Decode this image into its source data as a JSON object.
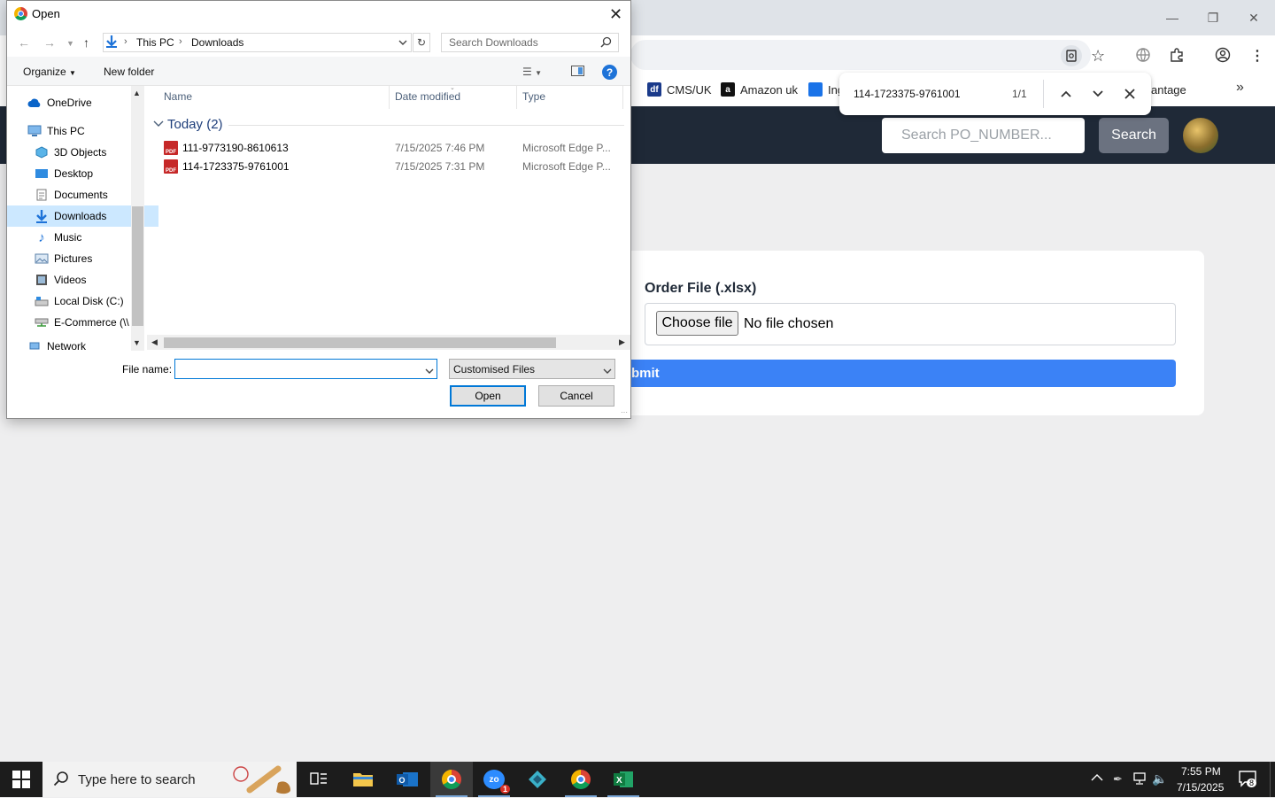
{
  "browser": {
    "bookmarks": [
      {
        "label": "CMS/UK",
        "icon_text": "df",
        "color": "#1a3a8a"
      },
      {
        "label": "Amazon uk",
        "icon_text": "a",
        "color": "#111111"
      },
      {
        "label": "Ing",
        "icon_text": "",
        "color": "#1a73e8"
      },
      {
        "label": "antage"
      }
    ],
    "more_bookmarks": "»"
  },
  "find_bar": {
    "query": "114-1723375-9761001",
    "count": "1/1"
  },
  "app": {
    "search_placeholder": "Search PO_NUMBER...",
    "search_button": "Search",
    "order_file_label": "Order File (.xlsx)",
    "choose_file_label": "Choose file",
    "no_file_text": "No file chosen",
    "submit_label": "bmit",
    "accent": "#3b82f6",
    "header_color": "#1f2937"
  },
  "dialog": {
    "title": "Open",
    "breadcrumb": [
      "This PC",
      "Downloads"
    ],
    "search_placeholder": "Search Downloads",
    "organize_label": "Organize",
    "new_folder_label": "New folder",
    "nav_items": [
      {
        "label": "OneDrive",
        "icon": "cloud-icon"
      },
      {
        "label": "This PC",
        "icon": "computer-icon"
      },
      {
        "label": "3D Objects",
        "icon": "cube-icon"
      },
      {
        "label": "Desktop",
        "icon": "desktop-icon"
      },
      {
        "label": "Documents",
        "icon": "document-icon"
      },
      {
        "label": "Downloads",
        "icon": "download-icon",
        "selected": true
      },
      {
        "label": "Music",
        "icon": "music-icon"
      },
      {
        "label": "Pictures",
        "icon": "picture-icon"
      },
      {
        "label": "Videos",
        "icon": "video-icon"
      },
      {
        "label": "Local Disk (C:)",
        "icon": "disk-icon"
      },
      {
        "label": "E-Commerce (\\\\",
        "icon": "network-drive-icon"
      },
      {
        "label": "Network",
        "icon": "network-icon"
      }
    ],
    "columns": [
      "Name",
      "Date modified",
      "Type"
    ],
    "group_label": "Today (2)",
    "files": [
      {
        "name": "111-9773190-8610613",
        "date": "7/15/2025 7:46 PM",
        "type": "Microsoft Edge P..."
      },
      {
        "name": "114-1723375-9761001",
        "date": "7/15/2025 7:31 PM",
        "type": "Microsoft Edge P..."
      }
    ],
    "file_name_label": "File name:",
    "file_name_value": "",
    "filter_value": "Customised Files",
    "open_button": "Open",
    "cancel_button": "Cancel"
  },
  "taskbar": {
    "search_placeholder": "Type here to search",
    "time": "7:55 PM",
    "date": "7/15/2025",
    "notification_count": "8",
    "zoom_badge": "1"
  }
}
